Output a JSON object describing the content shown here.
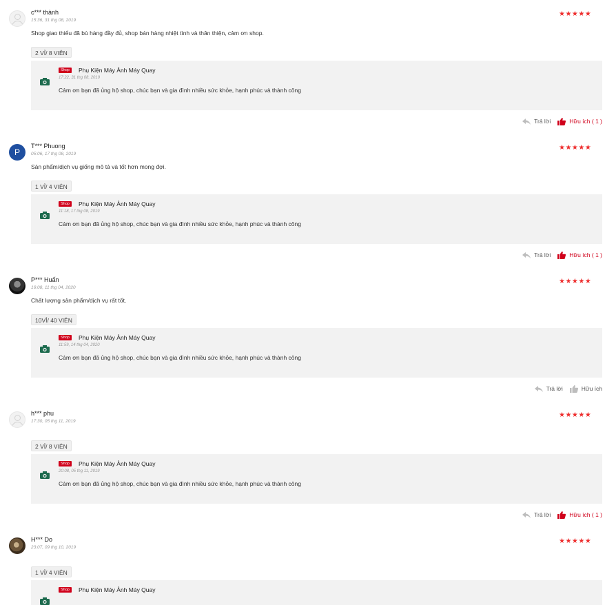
{
  "reviews": [
    {
      "username": "c*** thành",
      "time": "15:36, 31 thg 08, 2019",
      "avatar": "default-avatar-icon",
      "stars": "★★★★★",
      "comment": "Shop giao thiếu đã bù hàng đầy đủ, shop bán hàng nhiệt tình và thân thiện, cảm ơn shop.",
      "variation": "2 VỈ/ 8 VIÊN",
      "reply": {
        "tag": "Shop",
        "shop_name": "Phụ Kiện Máy Ảnh Máy Quay",
        "time": "17:22, 31 thg 08, 2019",
        "text": "Cảm ơn bạn đã ủng hộ shop, chúc bạn và gia đình nhiều sức khỏe, hạnh phúc và thành công"
      },
      "reply_label": "Trả lời",
      "helpful_label": "Hữu ích ( 1 )",
      "helpful_active": true
    },
    {
      "username": "T*** Phuong",
      "time": "05:06, 17 thg 08, 2019",
      "avatar": "P",
      "stars": "★★★★★",
      "comment": "Sản phẩm/dịch vụ giống mô tả và tốt hơn mong đợi.",
      "variation": "1 VỈ/ 4 VIÊN",
      "reply": {
        "tag": "Shop",
        "shop_name": "Phụ Kiện Máy Ảnh Máy Quay",
        "time": "11:18, 17 thg 08, 2019",
        "text": "Cảm ơn bạn đã ủng hộ shop, chúc bạn và gia đình nhiều sức khỏe, hạnh phúc và thành công"
      },
      "reply_label": "Trả lời",
      "helpful_label": "Hữu ích ( 1 )",
      "helpful_active": true
    },
    {
      "username": "P*** Huấn",
      "time": "16:08, 11 thg 04, 2020",
      "avatar": "photo-avatar-icon",
      "stars": "★★★★★",
      "comment": "Chất lượng sản phẩm/dịch vụ rất tốt.",
      "variation": "10VỈ/ 40 VIÊN",
      "reply": {
        "tag": "Shop",
        "shop_name": "Phụ Kiện Máy Ảnh Máy Quay",
        "time": "11:59, 14 thg 04, 2020",
        "text": "Cảm ơn bạn đã ủng hộ shop, chúc bạn và gia đình nhiều sức khỏe, hạnh phúc và thành công"
      },
      "reply_label": "Trả lời",
      "helpful_label": "Hữu ích",
      "helpful_active": false
    },
    {
      "username": "h*** phu",
      "time": "17:30, 05 thg 11, 2019",
      "avatar": "default-avatar-icon",
      "stars": "★★★★★",
      "comment": "",
      "variation": "2 VỈ/ 8 VIÊN",
      "reply": {
        "tag": "Shop",
        "shop_name": "Phụ Kiện Máy Ảnh Máy Quay",
        "time": "20:08, 05 thg 11, 2019",
        "text": "Cảm ơn bạn đã ủng hộ shop, chúc bạn và gia đình nhiều sức khỏe, hạnh phúc và thành công"
      },
      "reply_label": "Trả lời",
      "helpful_label": "Hữu ích ( 1 )",
      "helpful_active": true
    },
    {
      "username": "H*** Do",
      "time": "23:07, 09 thg 10, 2019",
      "avatar": "photo-avatar-icon",
      "stars": "★★★★★",
      "comment": "",
      "variation": "1 VỈ/ 4 VIÊN",
      "reply": {
        "tag": "Shop",
        "shop_name": "Phụ Kiện Máy Ảnh Máy Quay",
        "time": "",
        "text": ""
      },
      "reply_label": "",
      "helpful_label": "",
      "helpful_active": false
    }
  ],
  "colors": {
    "accent": "#d0011b",
    "star": "#ee2d2d",
    "shop_icon": "#1d6b4e"
  }
}
